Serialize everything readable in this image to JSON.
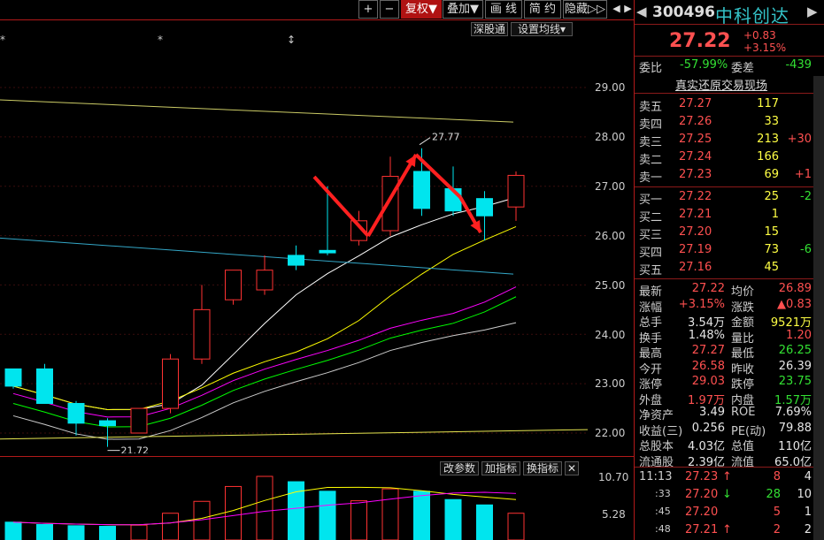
{
  "toolbar": {
    "plus": "+",
    "minus": "−",
    "fuquan": "复权▼",
    "diejia": "叠加▼",
    "huaxian": "画 线",
    "jianyue": "简 约",
    "yincang": "隐藏▷▷",
    "nav_left": "◀",
    "nav_right": "▶"
  },
  "chart_buttons": {
    "shengutong": "深股通",
    "set_ma": "设置均线▾"
  },
  "markers": [
    "*",
    "*",
    "↕"
  ],
  "price_axis": [
    "29.00",
    "28.00",
    "27.00",
    "26.00",
    "25.00",
    "24.00",
    "23.00",
    "22.00"
  ],
  "annotations": {
    "high": "27.77",
    "low": "21.72"
  },
  "indicator_buttons": {
    "change_params": "改参数",
    "add_indicator": "加指标",
    "swap_indicator": "换指标",
    "close": "✕"
  },
  "volume_axis": [
    "10.70",
    "5.28"
  ],
  "colors": {
    "up": "#ff3232",
    "down": "#00e5ee",
    "ma5": "#ffffff",
    "ma10": "#ffff00",
    "ma20": "#ff00ff",
    "ma30": "#00ff00",
    "ma60": "#cccccc",
    "arrow": "#ff2020"
  },
  "chart_data": {
    "type": "candlestick",
    "candles": [
      {
        "o": 23.3,
        "h": 23.3,
        "l": 22.9,
        "c": 22.95
      },
      {
        "o": 23.3,
        "h": 23.4,
        "l": 22.6,
        "c": 22.6
      },
      {
        "o": 22.6,
        "h": 22.65,
        "l": 21.95,
        "c": 22.2
      },
      {
        "o": 22.25,
        "h": 22.3,
        "l": 21.72,
        "c": 22.15
      },
      {
        "o": 22.0,
        "h": 22.5,
        "l": 22.0,
        "c": 22.5
      },
      {
        "o": 22.5,
        "h": 23.6,
        "l": 22.4,
        "c": 23.5
      },
      {
        "o": 23.5,
        "h": 25.0,
        "l": 23.4,
        "c": 24.5
      },
      {
        "o": 24.7,
        "h": 25.3,
        "l": 24.6,
        "c": 25.3
      },
      {
        "o": 24.9,
        "h": 25.6,
        "l": 24.8,
        "c": 25.3
      },
      {
        "o": 25.6,
        "h": 25.8,
        "l": 25.3,
        "c": 25.4
      },
      {
        "o": 25.7,
        "h": 27.0,
        "l": 25.6,
        "c": 25.65
      },
      {
        "o": 25.9,
        "h": 26.5,
        "l": 25.8,
        "c": 26.3
      },
      {
        "o": 26.1,
        "h": 27.6,
        "l": 26.0,
        "c": 27.2
      },
      {
        "o": 27.3,
        "h": 27.77,
        "l": 26.4,
        "c": 26.55
      },
      {
        "o": 26.95,
        "h": 27.4,
        "l": 26.4,
        "c": 26.5
      },
      {
        "o": 26.75,
        "h": 26.9,
        "l": 25.9,
        "c": 26.4
      },
      {
        "o": 26.58,
        "h": 27.3,
        "l": 26.3,
        "c": 27.22
      }
    ],
    "volume": [
      3.0,
      2.6,
      2.4,
      2.3,
      2.5,
      4.5,
      6.5,
      9.0,
      10.7,
      9.8,
      8.2,
      6.6,
      8.6,
      8.2,
      6.8,
      5.9,
      4.5
    ]
  },
  "quote": {
    "code": "300496",
    "name": "中科创达",
    "price": "27.22",
    "change": "+0.83",
    "change_pct": "+3.15%",
    "weibi_label": "委比",
    "weibi": "-57.99%",
    "weicha_label": "委差",
    "weicha": "-439",
    "link": "真实还原交易现场",
    "asks": [
      {
        "label": "卖五",
        "price": "27.27",
        "vol": "117",
        "delta": ""
      },
      {
        "label": "卖四",
        "price": "27.26",
        "vol": "33",
        "delta": ""
      },
      {
        "label": "卖三",
        "price": "27.25",
        "vol": "213",
        "delta": "+30"
      },
      {
        "label": "卖二",
        "price": "27.24",
        "vol": "166",
        "delta": ""
      },
      {
        "label": "卖一",
        "price": "27.23",
        "vol": "69",
        "delta": "+1"
      }
    ],
    "bids": [
      {
        "label": "买一",
        "price": "27.22",
        "vol": "25",
        "delta": "-2"
      },
      {
        "label": "买二",
        "price": "27.21",
        "vol": "1",
        "delta": ""
      },
      {
        "label": "买三",
        "price": "27.20",
        "vol": "15",
        "delta": ""
      },
      {
        "label": "买四",
        "price": "27.19",
        "vol": "73",
        "delta": "-6"
      },
      {
        "label": "买五",
        "price": "27.16",
        "vol": "45",
        "delta": ""
      }
    ],
    "stats": [
      {
        "l1": "最新",
        "v1": "27.22",
        "c1": "red",
        "l2": "均价",
        "v2": "26.89",
        "c2": "red"
      },
      {
        "l1": "涨幅",
        "v1": "+3.15%",
        "c1": "red",
        "l2": "涨跌",
        "v2": "▲0.83",
        "c2": "red"
      },
      {
        "l1": "总手",
        "v1": "3.54万",
        "c1": "wht",
        "l2": "金额",
        "v2": "9521万",
        "c2": "yel"
      },
      {
        "l1": "换手",
        "v1": "1.48%",
        "c1": "wht",
        "l2": "量比",
        "v2": "1.20",
        "c2": "red"
      },
      {
        "l1": "最高",
        "v1": "27.27",
        "c1": "red",
        "l2": "最低",
        "v2": "26.25",
        "c2": "grn"
      },
      {
        "l1": "今开",
        "v1": "26.58",
        "c1": "red",
        "l2": "昨收",
        "v2": "26.39",
        "c2": "wht"
      },
      {
        "l1": "涨停",
        "v1": "29.03",
        "c1": "red",
        "l2": "跌停",
        "v2": "23.75",
        "c2": "grn"
      },
      {
        "l1": "外盘",
        "v1": "1.97万",
        "c1": "red",
        "l2": "内盘",
        "v2": "1.57万",
        "c2": "grn"
      },
      {
        "l1": "净资产",
        "v1": "3.49",
        "c1": "wht",
        "l2": "ROE",
        "v2": "7.69%",
        "c2": "wht"
      },
      {
        "l1": "收益(三)",
        "v1": "0.256",
        "c1": "wht",
        "l2": "PE(动)",
        "v2": "79.88",
        "c2": "wht"
      },
      {
        "l1": "总股本",
        "v1": "4.03亿",
        "c1": "wht",
        "l2": "总值",
        "v2": "110亿",
        "c2": "wht"
      },
      {
        "l1": "流通股",
        "v1": "2.39亿",
        "c1": "wht",
        "l2": "流值",
        "v2": "65.0亿",
        "c2": "wht"
      }
    ],
    "ticks": [
      {
        "time": "11:13",
        "price": "27.23",
        "arrow": "↑",
        "ac": "red",
        "vol": "8",
        "n": "4"
      },
      {
        "time": ":33",
        "price": "27.20",
        "arrow": "↓",
        "ac": "grn",
        "vol": "28",
        "n": "10"
      },
      {
        "time": ":45",
        "price": "27.20",
        "arrow": "",
        "ac": "wht",
        "vol": "5",
        "n": "1"
      },
      {
        "time": ":48",
        "price": "27.21",
        "arrow": "↑",
        "ac": "red",
        "vol": "2",
        "n": "2"
      }
    ]
  }
}
